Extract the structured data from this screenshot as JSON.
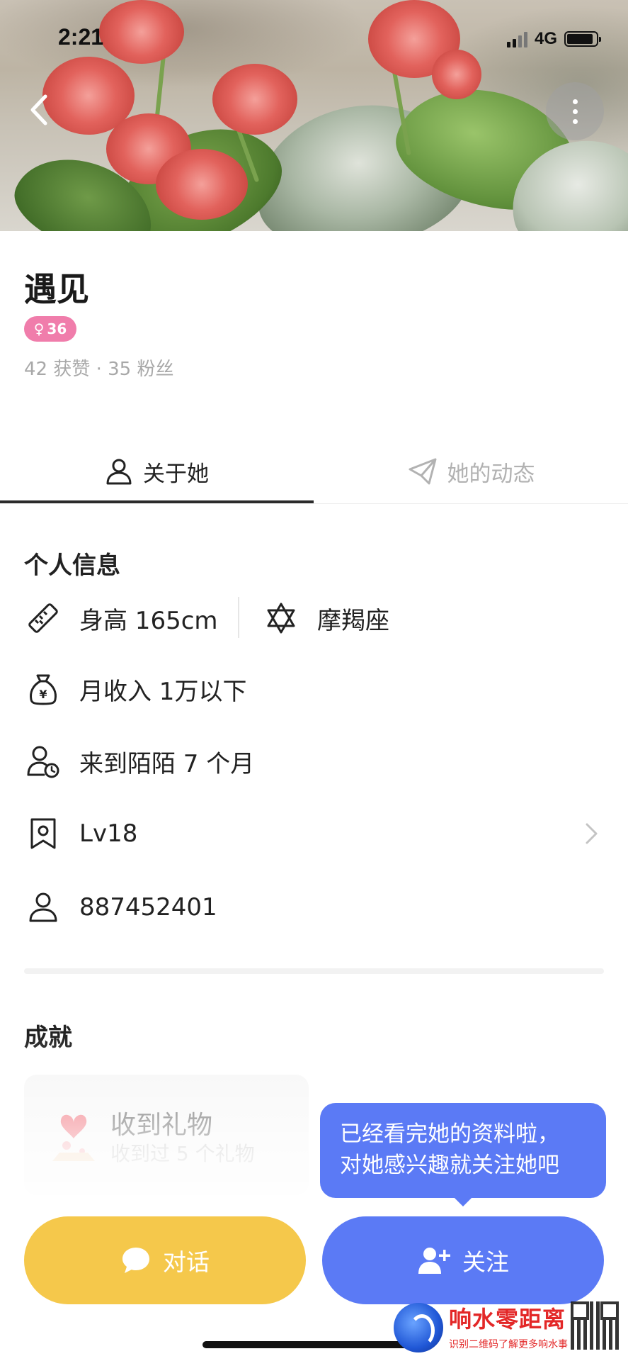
{
  "status_bar": {
    "time": "2:21",
    "network": "4G"
  },
  "profile": {
    "name": "遇见",
    "age": "36",
    "gender_symbol": "♀",
    "badge_color": "#f07dab",
    "stats": "42 获赞 · 35 粉丝"
  },
  "tabs": [
    {
      "label": "关于她",
      "icon": "person-icon",
      "active": true
    },
    {
      "label": "她的动态",
      "icon": "send-icon",
      "active": false
    }
  ],
  "personal_info": {
    "title": "个人信息",
    "height": "身高 165cm",
    "zodiac": "摩羯座",
    "income": "月收入 1万以下",
    "membership": "来到陌陌 7 个月",
    "level": "Lv18",
    "user_id": "887452401"
  },
  "achievements": {
    "title": "成就",
    "gift_title": "收到礼物",
    "gift_subtitle": "收到过 5 个礼物"
  },
  "tooltip": {
    "line1": "已经看完她的资料啦，",
    "line2": "对她感兴趣就关注她吧"
  },
  "actions": {
    "chat_label": "对话",
    "follow_label": "关注",
    "chat_color": "#f5c84b",
    "follow_color": "#5b7af5"
  },
  "watermark": {
    "title": "响水零距离",
    "subtitle": "识别二维码了解更多响水事"
  }
}
